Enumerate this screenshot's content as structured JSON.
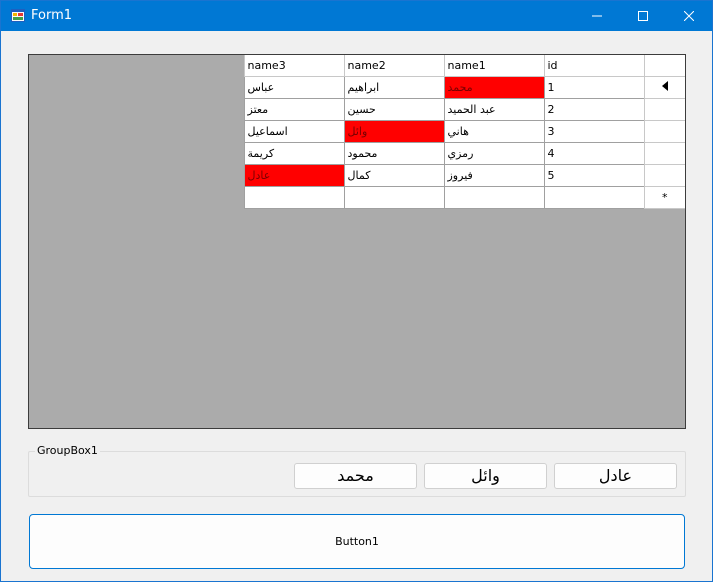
{
  "window": {
    "title": "Form1"
  },
  "grid": {
    "columns": [
      "id",
      "name1",
      "name2",
      "name3"
    ],
    "rows": [
      {
        "id": "1",
        "name1": "محمد",
        "name2": "ابراهيم",
        "name3": "عباس"
      },
      {
        "id": "2",
        "name1": "عبد الحميد",
        "name2": "حسين",
        "name3": "معتز"
      },
      {
        "id": "3",
        "name1": "هاني",
        "name2": "وائل",
        "name3": "اسماعيل"
      },
      {
        "id": "4",
        "name1": "رمزي",
        "name2": "محمود",
        "name3": "كريمة"
      },
      {
        "id": "5",
        "name1": "فيروز",
        "name2": "كمال",
        "name3": "عادل"
      }
    ],
    "new_row_marker": "*",
    "highlight_color": "#ff0000"
  },
  "groupbox": {
    "title": "GroupBox1",
    "buttons": [
      "عادل",
      "وائل",
      "محمد"
    ]
  },
  "main_button": {
    "label": "Button1"
  }
}
